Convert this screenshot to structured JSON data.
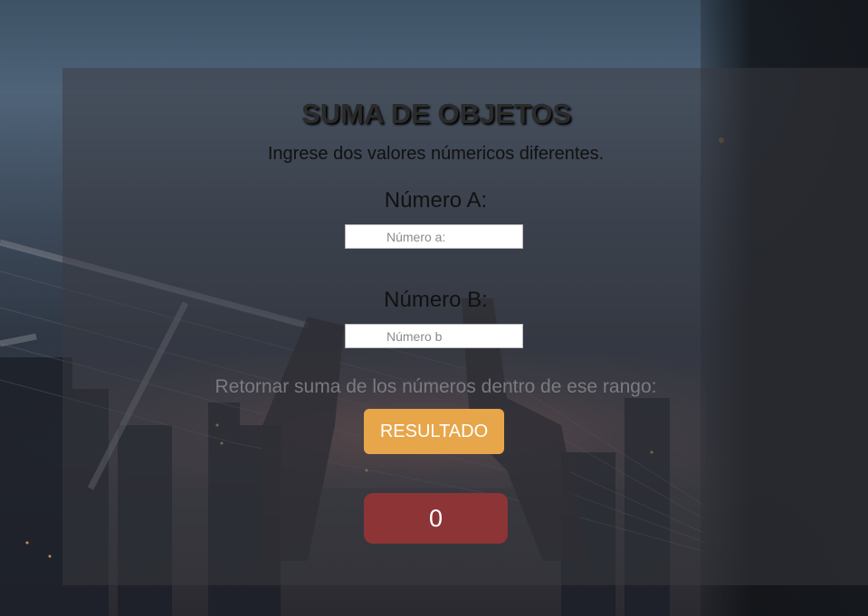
{
  "app": {
    "title": "SUMA DE OBJETOS",
    "subtitle": "Ingrese dos valores númericos diferentes."
  },
  "form": {
    "label_a": "Número A:",
    "placeholder_a": "Número a:",
    "value_a": "",
    "label_b": "Número B:",
    "placeholder_b": "Número b",
    "value_b": "",
    "range_text": "Retornar suma de los números dentro de ese rango:",
    "button_label": "RESULTADO"
  },
  "result": {
    "value": "0"
  },
  "colors": {
    "button_bg": "#e7a64a",
    "result_bg": "#8c3436",
    "panel_bg": "rgba(58,58,64,0.5)"
  },
  "background": {
    "description_icon": "city-bridge-dusk-photo"
  }
}
